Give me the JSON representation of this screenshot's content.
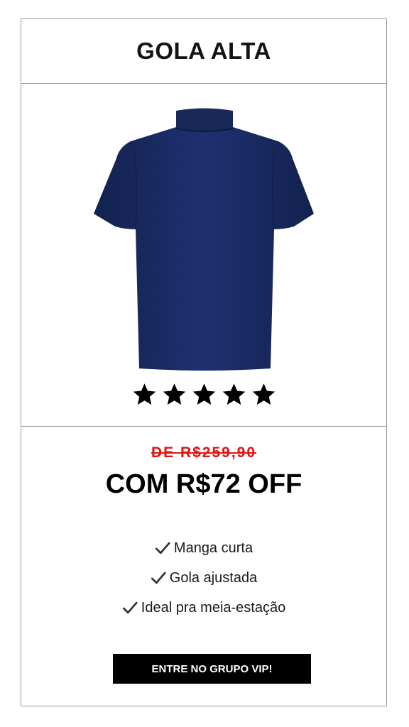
{
  "header": {
    "title": "GOLA ALTA"
  },
  "product": {
    "image_icon": "navy-mock-neck-tshirt",
    "color": "#1c2d6b",
    "rating": 5,
    "rating_max": 5
  },
  "pricing": {
    "old_price": "DE R$259,90",
    "discount": "COM R$72 OFF",
    "old_price_color": "#e01414"
  },
  "features": [
    {
      "icon": "check-icon",
      "label": "Manga curta"
    },
    {
      "icon": "check-icon",
      "label": "Gola ajustada"
    },
    {
      "icon": "check-icon",
      "label": "Ideal pra meia-estação"
    }
  ],
  "cta": {
    "label": "ENTRE NO GRUPO VIP!"
  }
}
